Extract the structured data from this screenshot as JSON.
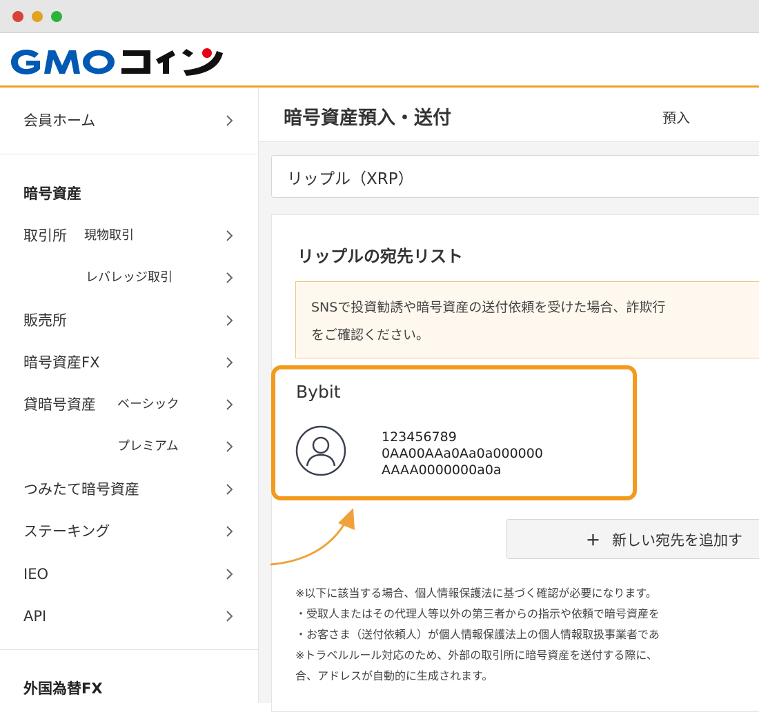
{
  "window": {
    "controls": [
      "close",
      "minimize",
      "maximize"
    ]
  },
  "header": {
    "logo_text": "GMOコイン",
    "logo_colors": {
      "gmo": "#0059b3",
      "coin": "#111111",
      "dot": "#e60012"
    },
    "accent": "#f0a023"
  },
  "sidebar": {
    "member_home": "会員ホーム",
    "section_crypto": "暗号資産",
    "exchange": "取引所",
    "spot": "現物取引",
    "leverage": "レバレッジ取引",
    "sales": "販売所",
    "crypto_fx": "暗号資産FX",
    "lending": "貸暗号資産",
    "basic": "ベーシック",
    "premium": "プレミアム",
    "tsumitate": "つみたて暗号資産",
    "staking": "ステーキング",
    "ieo": "IEO",
    "api": "API",
    "section_fx": "外国為替FX"
  },
  "main": {
    "page_title": "暗号資産預入・送付",
    "tab_deposit": "預入",
    "select_value": "リップル（XRP）",
    "list_title": "リップルの宛先リスト",
    "notice_line1": "SNSで投資勧誘や暗号資産の送付依頼を受けた場合、詐欺行",
    "notice_line2": "をご確認ください。",
    "destination": {
      "name": "Bybit",
      "line1": "123456789",
      "line2": "0AA00AAa0Aa0a000000",
      "line3": "AAAA0000000a0a"
    },
    "add_button": "新しい宛先を追加す",
    "add_icon": "plus-icon",
    "notes": [
      "※以下に該当する場合、個人情報保護法に基づく確認が必要になります。",
      "・受取人またはその代理人等以外の第三者からの指示や依頼で暗号資産を",
      "・お客さま（送付依頼人）が個人情報保護法上の個人情報取扱事業者であ",
      "※トラベルルール対応のため、外部の取引所に暗号資産を送付する際に、",
      "合、アドレスが自動的に生成されます。"
    ]
  },
  "highlight_color": "#f39a1d"
}
